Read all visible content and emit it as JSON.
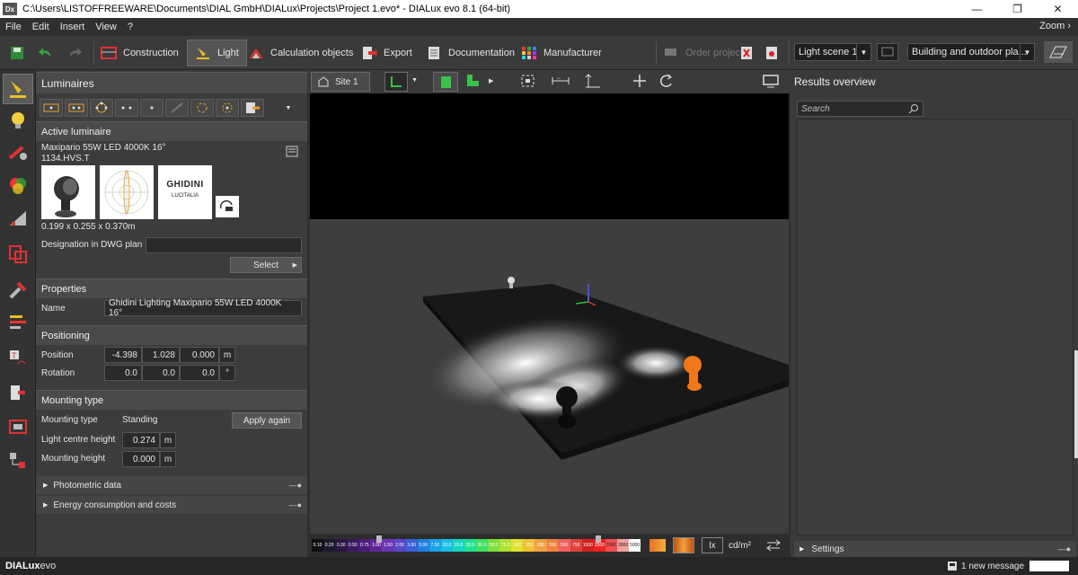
{
  "window": {
    "app_icon": "Dx",
    "title": "C:\\Users\\LISTOFFREEWARE\\Documents\\DIAL GmbH\\DIALux\\Projects\\Project 1.evo* - DIALux evo 8.1  (64-bit)"
  },
  "menu": {
    "items": [
      "File",
      "Edit",
      "Insert",
      "View",
      "?"
    ],
    "zoom": "Zoom ›"
  },
  "ribbon": {
    "tabs": [
      "Construction",
      "Light",
      "Calculation objects",
      "Export",
      "Documentation",
      "Manufacturer"
    ],
    "active_tab": "Light",
    "order_project": "Order project",
    "light_scene": "Light scene 1",
    "planning_mode": "Building and outdoor pla..."
  },
  "luminaires_panel": {
    "title": "Luminaires",
    "active_section": "Active luminaire",
    "luminaire_name": "Maxipario 55W LED 4000K 16°",
    "luminaire_code": "1134.HVS.T",
    "brand_logo": "GHIDINI",
    "brand_sub": "LUCITALIA",
    "dimensions": "0.199 x 0.255 x 0.370m",
    "designation_label": "Designation in DWG plan",
    "designation_value": "",
    "select_button": "Select"
  },
  "properties": {
    "title": "Properties",
    "name_label": "Name",
    "name_value": "Ghidini Lighting  Maxipario 55W LED 4000K 16°"
  },
  "positioning": {
    "title": "Positioning",
    "position_label": "Position",
    "position": [
      "-4.398",
      "1.028",
      "0.000"
    ],
    "position_unit": "m",
    "rotation_label": "Rotation",
    "rotation": [
      "0.0",
      "0.0",
      "0.0"
    ],
    "rotation_unit": "°"
  },
  "mounting": {
    "title": "Mounting type",
    "type_label": "Mounting type",
    "type_value": "Standing",
    "apply_button": "Apply again",
    "centre_label": "Light centre height",
    "centre_value": "0.274",
    "height_label": "Mounting height",
    "height_value": "0.000",
    "unit": "m"
  },
  "collapsed_sections": [
    "Photometric data",
    "Energy consumption and costs"
  ],
  "viewport": {
    "site_button": "Site 1",
    "legend_values": [
      "0.10",
      "0.20",
      "0.30",
      "0.50",
      "0.75",
      "1.00",
      "1.50",
      "2.00",
      "3.00",
      "5.00",
      "7.50",
      "10.0",
      "15.0",
      "20.0",
      "30.0",
      "50.0",
      "75.0",
      "100",
      "150",
      "200",
      "300",
      "500",
      "750",
      "1000",
      "1500",
      "2000",
      "3000",
      "5000"
    ],
    "legend_colors": [
      "#101010",
      "#1a1a2e",
      "#2b1740",
      "#3a1a5e",
      "#4b1c7c",
      "#5e2597",
      "#6b35b5",
      "#5848c8",
      "#3a5ed6",
      "#2080e0",
      "#1aa0e8",
      "#18bfe0",
      "#18d6c0",
      "#20e090",
      "#40e060",
      "#7ae040",
      "#b0e030",
      "#e0e030",
      "#f0c030",
      "#f0a040",
      "#f08040",
      "#f06060",
      "#e04040",
      "#d02020",
      "#f02020",
      "#f05050",
      "#f0a0a0",
      "#ffffff"
    ],
    "unit_lx": "lx",
    "unit_cd": "cd/m²"
  },
  "results": {
    "title": "Results overview",
    "search_placeholder": "Search",
    "settings": "Settings"
  },
  "status": {
    "logo_bold": "DIALux",
    "logo_rest": "evo",
    "message": "1 new message"
  }
}
